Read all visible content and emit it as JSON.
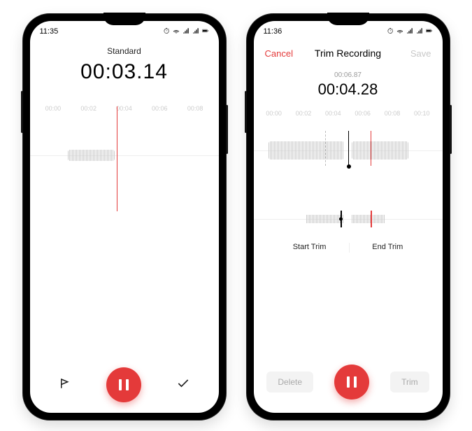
{
  "phone1": {
    "status": {
      "time": "11:35"
    },
    "header": {
      "title": "Standard"
    },
    "main_time": "00:03.14",
    "ticks": [
      "00:00",
      "00:02",
      "00:04",
      "00:06",
      "00:08"
    ],
    "controls": {
      "flag": "flag-icon",
      "pause": "pause-button",
      "done": "done-check"
    }
  },
  "phone2": {
    "status": {
      "time": "11:36"
    },
    "header": {
      "cancel": "Cancel",
      "title": "Trim Recording",
      "save": "Save"
    },
    "total_time": "00:06.87",
    "current_time": "00:04.28",
    "ticks": [
      "00:00",
      "00:02",
      "00:04",
      "00:06",
      "00:08",
      "00:10"
    ],
    "trim_labels": {
      "start": "Start Trim",
      "end": "End Trim"
    },
    "bottom": {
      "delete": "Delete",
      "trim": "Trim"
    }
  },
  "colors": {
    "accent": "#e43a3a"
  }
}
